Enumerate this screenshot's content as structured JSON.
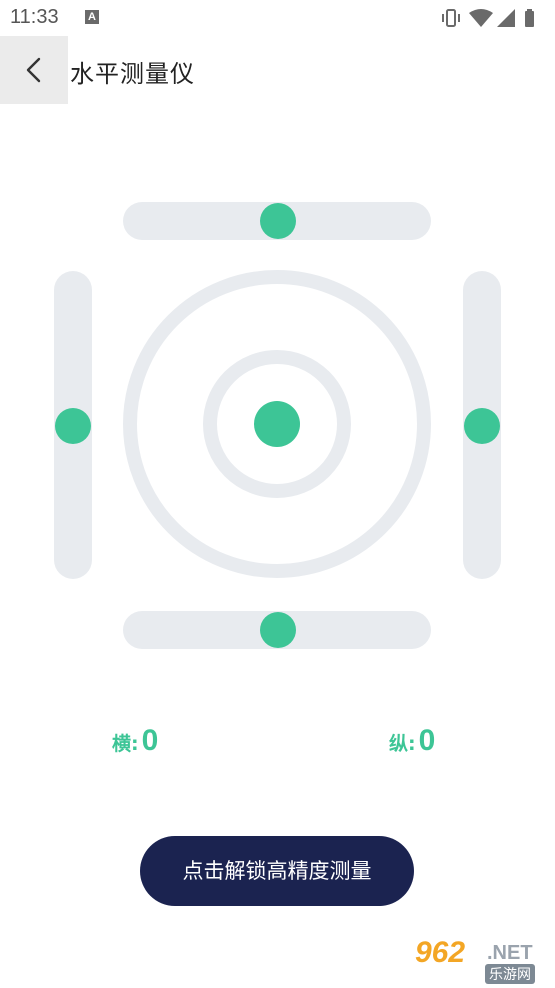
{
  "status_bar": {
    "time": "11:33",
    "notification_icon_letter": "A",
    "icons": [
      "vibrate-icon",
      "wifi-icon",
      "signal-icon",
      "battery-icon"
    ]
  },
  "app_bar": {
    "title": "水平测量仪",
    "back_icon": "chevron-left-icon"
  },
  "level": {
    "bubble_color": "#3dc596",
    "track_color": "#e8ebef"
  },
  "readouts": {
    "horizontal_label": "横:",
    "horizontal_value": "0",
    "vertical_label": "纵:",
    "vertical_value": "0"
  },
  "unlock_button": {
    "label": "点击解锁高精度测量",
    "color": "#1b2350"
  },
  "watermark": {
    "number": "962",
    "domain": ".NET",
    "chinese": "乐游网"
  }
}
